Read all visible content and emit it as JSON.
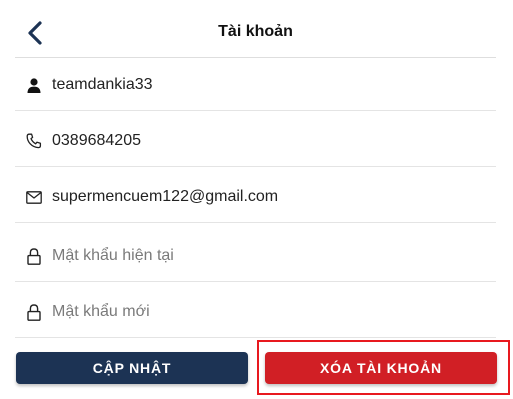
{
  "header": {
    "title": "Tài khoản",
    "back_icon": "chevron-left-icon"
  },
  "fields": {
    "username": {
      "icon": "user-icon",
      "value": "teamdankia33"
    },
    "phone": {
      "icon": "phone-icon",
      "value": "0389684205"
    },
    "email": {
      "icon": "mail-icon",
      "value": "supermencuem122@gmail.com"
    },
    "current_password": {
      "icon": "lock-icon",
      "placeholder": "Mật khẩu hiện tại",
      "value": ""
    },
    "new_password": {
      "icon": "lock-icon",
      "placeholder": "Mật khẩu mới",
      "value": ""
    }
  },
  "buttons": {
    "update_label": "CẬP NHẬT",
    "delete_label": "XÓA TÀI KHOẢN"
  },
  "colors": {
    "update_button": "#1c3354",
    "delete_button": "#d11f25",
    "highlight_border": "#e8191f"
  }
}
